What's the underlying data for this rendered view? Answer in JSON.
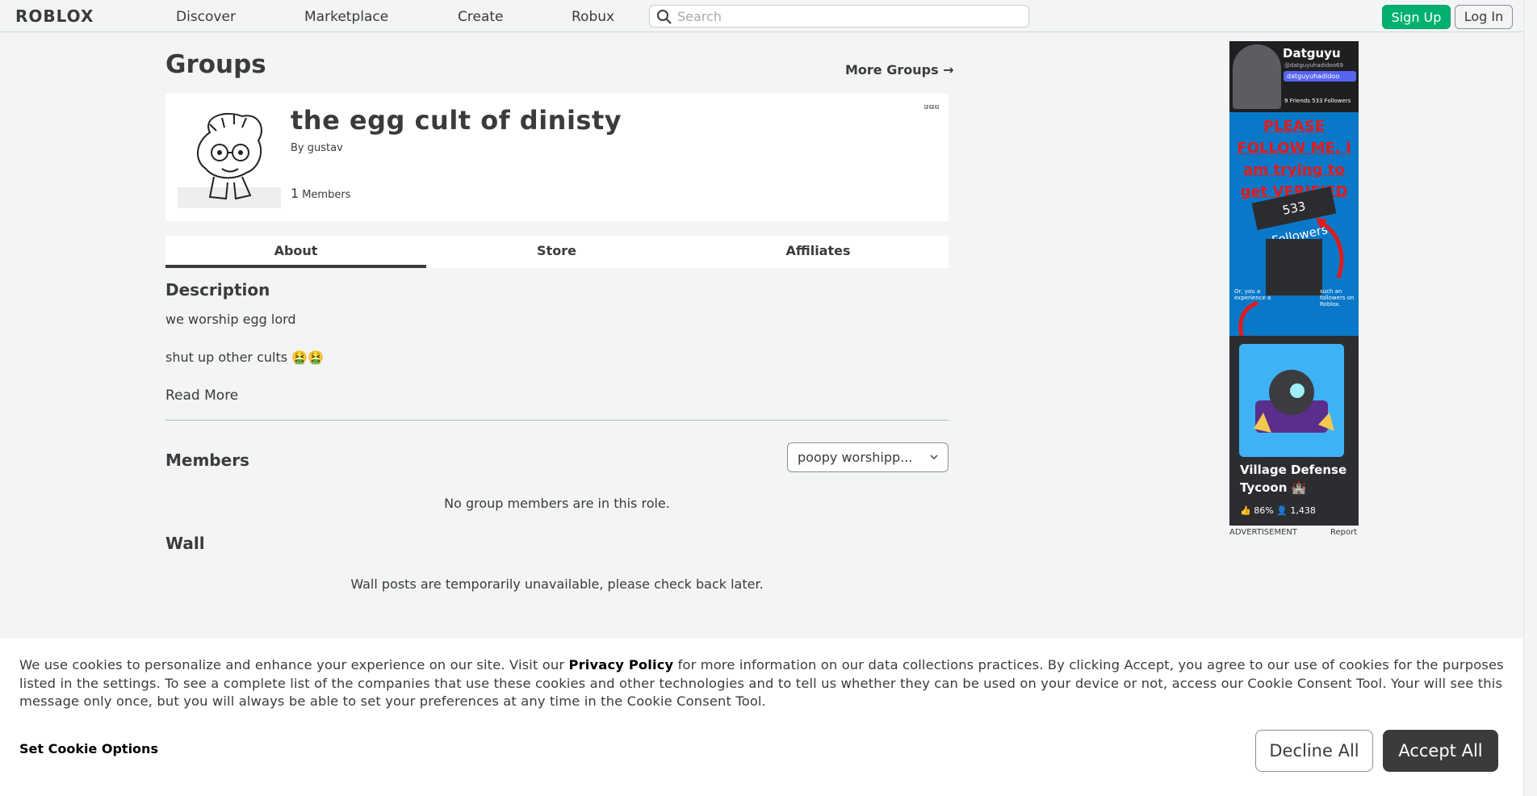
{
  "nav": {
    "logo": "ROBLOX",
    "links": [
      "Discover",
      "Marketplace",
      "Create",
      "Robux"
    ],
    "search_placeholder": "Search",
    "signup": "Sign Up",
    "login": "Log In"
  },
  "page": {
    "title": "Groups",
    "more_groups": "More Groups →"
  },
  "group": {
    "name": "the egg cult of dinisty",
    "by_prefix": "By",
    "owner": "gustav",
    "member_count": "1",
    "member_label": "Members"
  },
  "tabs": [
    {
      "label": "About",
      "active": true
    },
    {
      "label": "Store",
      "active": false
    },
    {
      "label": "Affiliates",
      "active": false
    }
  ],
  "about": {
    "description_heading": "Description",
    "description_lines": [
      "we worship egg lord",
      "shut up other cults 🤮🤮"
    ],
    "read_more": "Read More",
    "members_heading": "Members",
    "role_selected": "poopy worshipp...",
    "members_empty": "No group members are in this role.",
    "wall_heading": "Wall",
    "wall_empty": "Wall posts are temporarily unavailable, please check back later."
  },
  "ad": {
    "name": "Datguyu",
    "handle": "@datguyuhadidoo69",
    "chip": "datguyuhadidoo",
    "stats": "9 Friends   533 Followers",
    "callout": "PLEASE FOLLOW ME, I am trying to get VERIFIED",
    "followers_badge": "533 Followers",
    "small_left": "Or, you a experience a",
    "small_right": "such an followers on Roblox.",
    "game_title": "Village Defense Tycoon 🏰",
    "game_meta": "👍 86%    👤 1,438",
    "label": "ADVERTISEMENT",
    "report": "Report"
  },
  "cookie": {
    "text_before": "We use cookies to personalize and enhance your experience on our site. Visit our ",
    "privacy_link": "Privacy Policy",
    "text_after": " for more information on our data collections practices. By clicking Accept, you agree to our use of cookies for the purposes listed in the settings. To see a complete list of the companies that use these cookies and other technologies and to tell us whether they can be used on your device or not, access our Cookie Consent Tool. Your will see this message only once, but you will always be able to set your preferences at any time in the Cookie Consent Tool.",
    "options": "Set Cookie Options",
    "decline": "Decline All",
    "accept": "Accept All"
  }
}
